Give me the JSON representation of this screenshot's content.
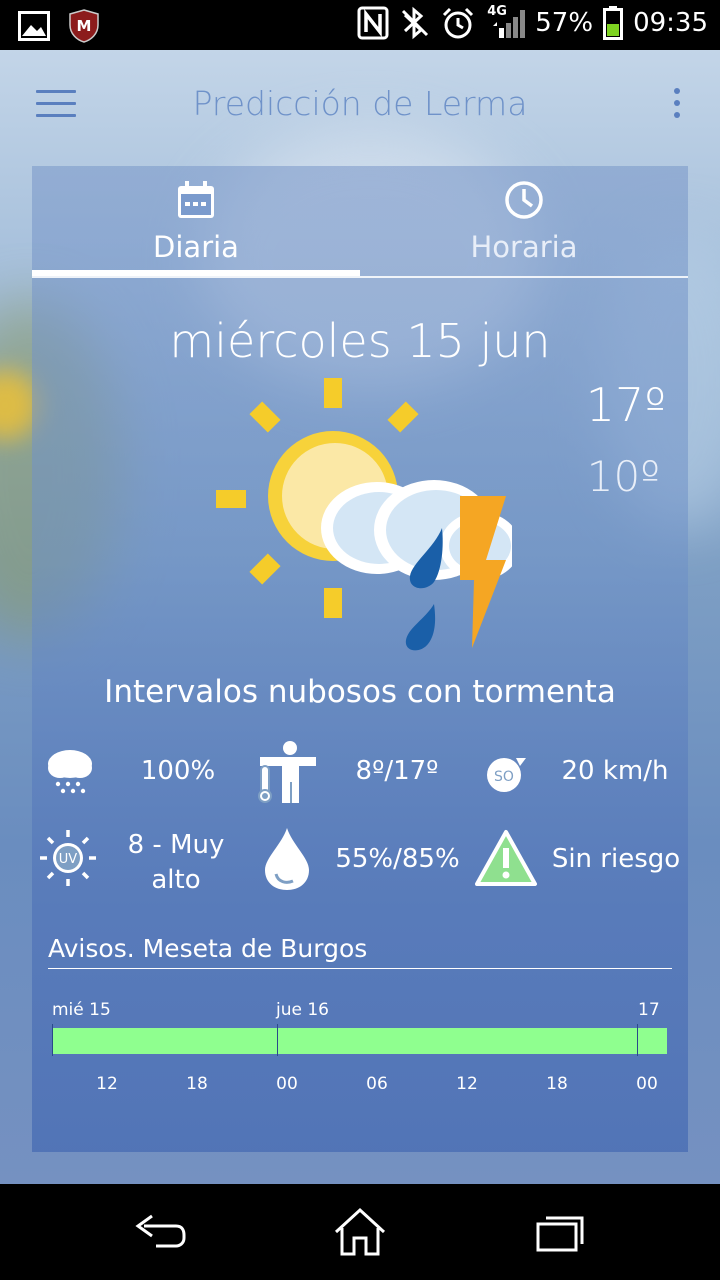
{
  "status_bar": {
    "battery_percent": "57%",
    "time": "09:35",
    "network_type": "4G",
    "icons_left": [
      "image-icon",
      "mcafee-icon"
    ],
    "icons_right": [
      "nfc-icon",
      "bluetooth-off-icon",
      "alarm-icon",
      "signal-icon",
      "battery-icon"
    ]
  },
  "header": {
    "title": "Predicción de Lerma"
  },
  "tabs": [
    {
      "label": "Diaria",
      "icon": "calendar-icon",
      "active": true
    },
    {
      "label": "Horaria",
      "icon": "clock-icon",
      "active": false
    }
  ],
  "forecast": {
    "date": "miércoles 15 jun",
    "temp_max": "17º",
    "temp_min": "10º",
    "condition": "Intervalos nubosos con tormenta",
    "stats": {
      "precip_prob": "100%",
      "temp_range": "8º/17º",
      "wind_dir": "SO",
      "wind_speed": "20 km/h",
      "uv_label": "UV",
      "uv_index": "8 - Muy",
      "uv_level": "alto",
      "humidity": "55%/85%",
      "risk": "Sin riesgo"
    }
  },
  "warnings": {
    "title": "Avisos. Meseta de Burgos",
    "day_labels": [
      "mié 15",
      "jue 16",
      "17"
    ],
    "hour_labels": [
      "12",
      "18",
      "00",
      "06",
      "12",
      "18",
      "00"
    ],
    "level_color": "#8fff8f"
  },
  "colors": {
    "sun": "#f7d23a",
    "sun_rays": "#f5cc2a",
    "bolt": "#f5a623",
    "rain": "#1a5fa8",
    "accent": "#5a7fbf"
  }
}
